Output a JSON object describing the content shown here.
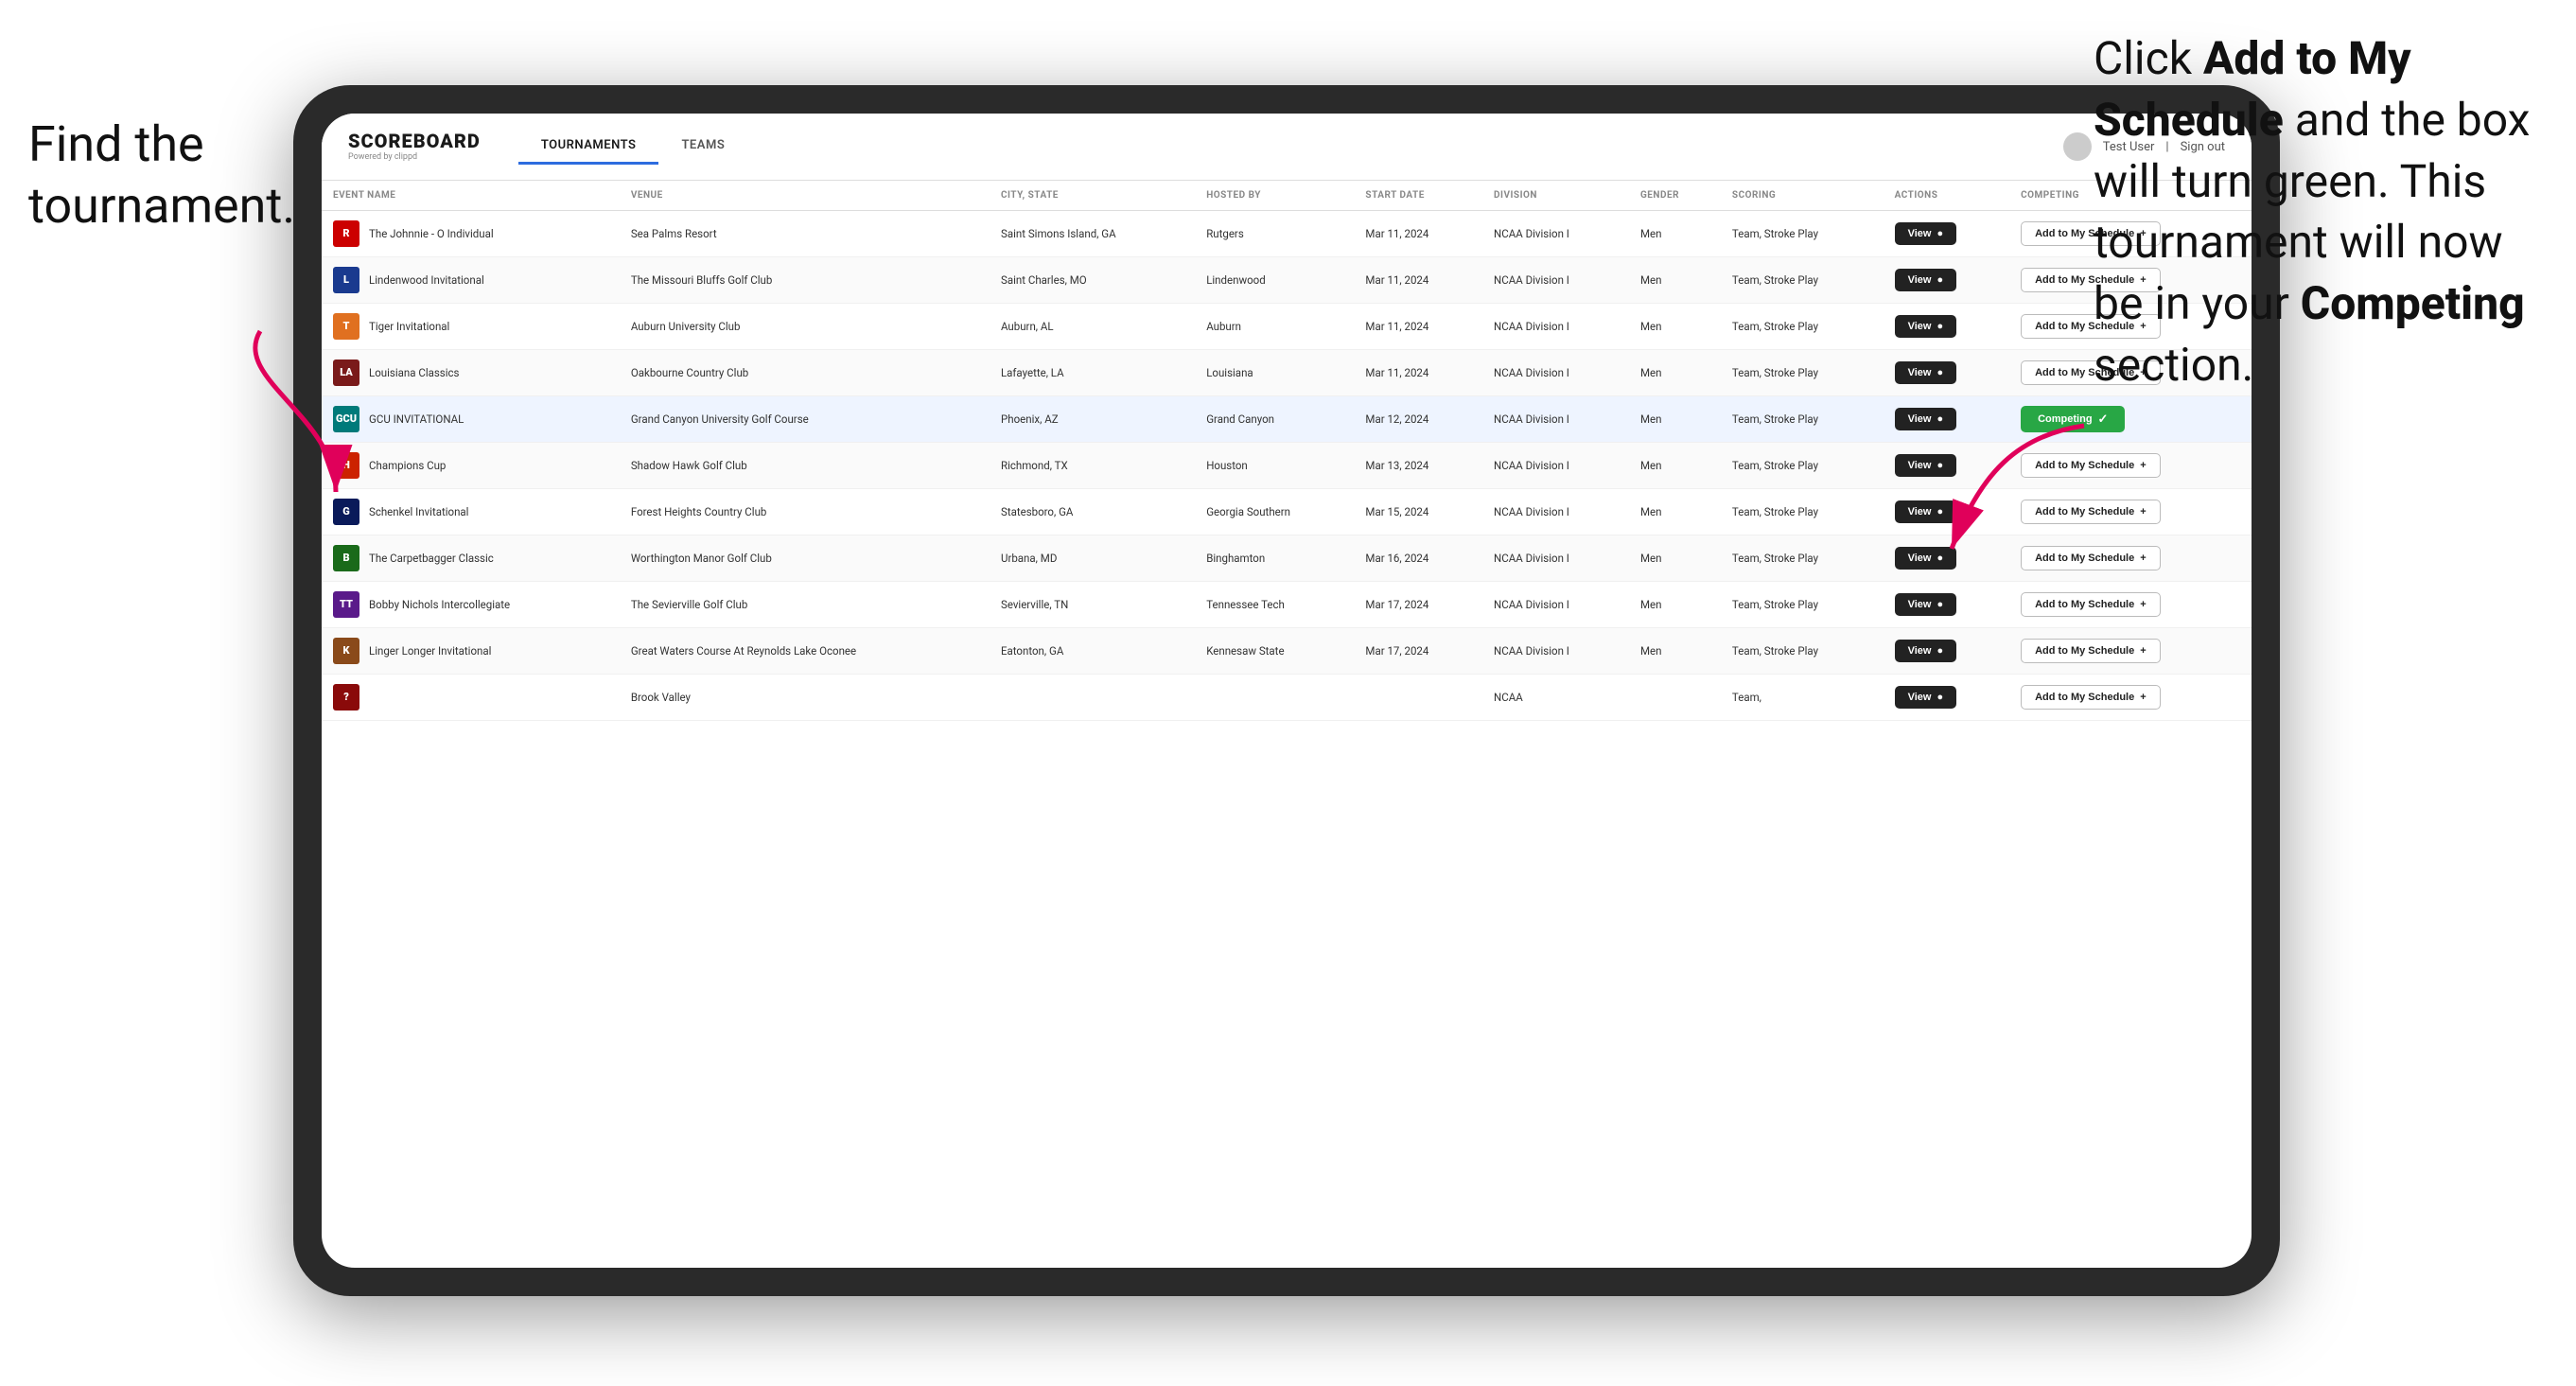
{
  "annotations": {
    "left": "Find the\ntournament.",
    "right_line1": "Click ",
    "right_bold1": "Add to My\nSchedule",
    "right_line2": " and the\nbox will turn green.\nThis tournament\nwill now be in\nyour ",
    "right_bold2": "Competing",
    "right_line3": "\nsection."
  },
  "header": {
    "logo": "SCOREBOARD",
    "logo_sub": "Powered by clippd",
    "nav_tabs": [
      "TOURNAMENTS",
      "TEAMS"
    ],
    "active_tab": "TOURNAMENTS",
    "user": "Test User",
    "sign_out": "Sign out"
  },
  "table": {
    "columns": [
      "EVENT NAME",
      "VENUE",
      "CITY, STATE",
      "HOSTED BY",
      "START DATE",
      "DIVISION",
      "GENDER",
      "SCORING",
      "ACTIONS",
      "COMPETING"
    ],
    "rows": [
      {
        "logo_text": "R",
        "logo_color": "red",
        "event": "The Johnnie - O Individual",
        "venue": "Sea Palms Resort",
        "city_state": "Saint Simons Island, GA",
        "hosted_by": "Rutgers",
        "start_date": "Mar 11, 2024",
        "division": "NCAA Division I",
        "gender": "Men",
        "scoring": "Team, Stroke Play",
        "action": "View",
        "competing": "Add to My Schedule",
        "is_competing": false,
        "highlighted": false
      },
      {
        "logo_text": "L",
        "logo_color": "blue",
        "event": "Lindenwood Invitational",
        "venue": "The Missouri Bluffs Golf Club",
        "city_state": "Saint Charles, MO",
        "hosted_by": "Lindenwood",
        "start_date": "Mar 11, 2024",
        "division": "NCAA Division I",
        "gender": "Men",
        "scoring": "Team, Stroke Play",
        "action": "View",
        "competing": "Add to My Schedule",
        "is_competing": false,
        "highlighted": false
      },
      {
        "logo_text": "T",
        "logo_color": "orange",
        "event": "Tiger Invitational",
        "venue": "Auburn University Club",
        "city_state": "Auburn, AL",
        "hosted_by": "Auburn",
        "start_date": "Mar 11, 2024",
        "division": "NCAA Division I",
        "gender": "Men",
        "scoring": "Team, Stroke Play",
        "action": "View",
        "competing": "Add to My Schedule",
        "is_competing": false,
        "highlighted": false
      },
      {
        "logo_text": "LA",
        "logo_color": "maroon",
        "event": "Louisiana Classics",
        "venue": "Oakbourne Country Club",
        "city_state": "Lafayette, LA",
        "hosted_by": "Louisiana",
        "start_date": "Mar 11, 2024",
        "division": "NCAA Division I",
        "gender": "Men",
        "scoring": "Team, Stroke Play",
        "action": "View",
        "competing": "Add to My Schedule",
        "is_competing": false,
        "highlighted": false
      },
      {
        "logo_text": "GCU",
        "logo_color": "teal",
        "event": "GCU INVITATIONAL",
        "venue": "Grand Canyon University Golf Course",
        "city_state": "Phoenix, AZ",
        "hosted_by": "Grand Canyon",
        "start_date": "Mar 12, 2024",
        "division": "NCAA Division I",
        "gender": "Men",
        "scoring": "Team, Stroke Play",
        "action": "View",
        "competing": "Competing",
        "is_competing": true,
        "highlighted": true
      },
      {
        "logo_text": "H",
        "logo_color": "red2",
        "event": "Champions Cup",
        "venue": "Shadow Hawk Golf Club",
        "city_state": "Richmond, TX",
        "hosted_by": "Houston",
        "start_date": "Mar 13, 2024",
        "division": "NCAA Division I",
        "gender": "Men",
        "scoring": "Team, Stroke Play",
        "action": "View",
        "competing": "Add to My Schedule",
        "is_competing": false,
        "highlighted": false
      },
      {
        "logo_text": "G",
        "logo_color": "navy",
        "event": "Schenkel Invitational",
        "venue": "Forest Heights Country Club",
        "city_state": "Statesboro, GA",
        "hosted_by": "Georgia Southern",
        "start_date": "Mar 15, 2024",
        "division": "NCAA Division I",
        "gender": "Men",
        "scoring": "Team, Stroke Play",
        "action": "View",
        "competing": "Add to My Schedule",
        "is_competing": false,
        "highlighted": false
      },
      {
        "logo_text": "B",
        "logo_color": "green",
        "event": "The Carpetbagger Classic",
        "venue": "Worthington Manor Golf Club",
        "city_state": "Urbana, MD",
        "hosted_by": "Binghamton",
        "start_date": "Mar 16, 2024",
        "division": "NCAA Division I",
        "gender": "Men",
        "scoring": "Team, Stroke Play",
        "action": "View",
        "competing": "Add to My Schedule",
        "is_competing": false,
        "highlighted": false
      },
      {
        "logo_text": "TT",
        "logo_color": "purple",
        "event": "Bobby Nichols Intercollegiate",
        "venue": "The Sevierville Golf Club",
        "city_state": "Sevierville, TN",
        "hosted_by": "Tennessee Tech",
        "start_date": "Mar 17, 2024",
        "division": "NCAA Division I",
        "gender": "Men",
        "scoring": "Team, Stroke Play",
        "action": "View",
        "competing": "Add to My Schedule",
        "is_competing": false,
        "highlighted": false
      },
      {
        "logo_text": "K",
        "logo_color": "brown",
        "event": "Linger Longer Invitational",
        "venue": "Great Waters Course At Reynolds Lake Oconee",
        "city_state": "Eatonton, GA",
        "hosted_by": "Kennesaw State",
        "start_date": "Mar 17, 2024",
        "division": "NCAA Division I",
        "gender": "Men",
        "scoring": "Team, Stroke Play",
        "action": "View",
        "competing": "Add to My Schedule",
        "is_competing": false,
        "highlighted": false
      },
      {
        "logo_text": "?",
        "logo_color": "darkred",
        "event": "",
        "venue": "Brook Valley",
        "city_state": "",
        "hosted_by": "",
        "start_date": "",
        "division": "NCAA",
        "gender": "",
        "scoring": "Team,",
        "action": "View",
        "competing": "Add to My Schedule",
        "is_competing": false,
        "highlighted": false
      }
    ]
  }
}
